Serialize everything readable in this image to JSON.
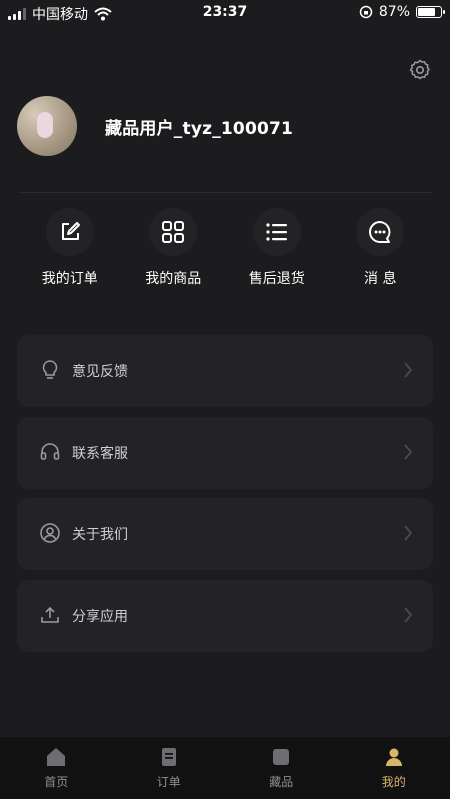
{
  "status_bar": {
    "carrier": "中国移动",
    "time": "23:37",
    "battery": "87%",
    "battery_level": 0.87
  },
  "profile": {
    "username": "藏品用户_tyz_100071"
  },
  "quick_actions": [
    {
      "label": "我的订单",
      "icon": "edit-icon"
    },
    {
      "label": "我的商品",
      "icon": "grid-icon"
    },
    {
      "label": "售后退货",
      "icon": "list-icon"
    },
    {
      "label": "消 息",
      "icon": "chat-icon"
    }
  ],
  "menu": [
    {
      "label": "意见反馈",
      "icon": "lightbulb-icon"
    },
    {
      "label": "联系客服",
      "icon": "headset-icon"
    },
    {
      "label": "关于我们",
      "icon": "user-circle-icon"
    },
    {
      "label": "分享应用",
      "icon": "share-icon"
    }
  ],
  "tabs": [
    {
      "label": "首页",
      "icon": "home-icon"
    },
    {
      "label": "订单",
      "icon": "orders-icon"
    },
    {
      "label": "藏品",
      "icon": "collection-icon"
    },
    {
      "label": "我的",
      "icon": "profile-icon",
      "active": true
    }
  ],
  "colors": {
    "background": "#1c1c1e",
    "card": "#232325",
    "active_tab": "#d8b56a"
  }
}
